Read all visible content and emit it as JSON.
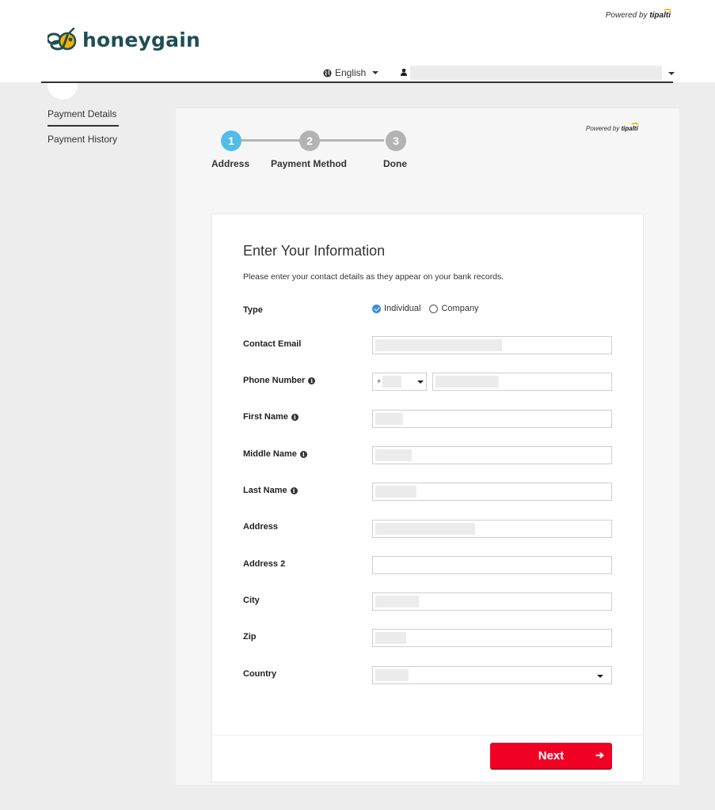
{
  "header": {
    "powered_by_prefix": "Powered by",
    "powered_by_brand": "tipalti",
    "logo_text": "honeygain",
    "language": "English"
  },
  "sidenav": {
    "items": [
      {
        "label": "Payment Details",
        "active": true
      },
      {
        "label": "Payment History",
        "active": false
      }
    ]
  },
  "panel": {
    "powered_by_prefix": "Powered by",
    "powered_by_brand": "tipalti"
  },
  "stepper": {
    "steps": [
      {
        "number": "1",
        "label": "Address",
        "active": true
      },
      {
        "number": "2",
        "label": "Payment Method",
        "active": false
      },
      {
        "number": "3",
        "label": "Done",
        "active": false
      }
    ]
  },
  "form": {
    "title": "Enter Your Information",
    "subtitle": "Please enter your contact details as they appear on your bank records.",
    "type": {
      "label": "Type",
      "options": [
        "Individual",
        "Company"
      ],
      "selected": "Individual"
    },
    "labels": {
      "contact_email": "Contact Email",
      "phone_number": "Phone Number",
      "first_name": "First Name",
      "middle_name": "Middle Name",
      "last_name": "Last Name",
      "address": "Address",
      "address2": "Address 2",
      "city": "City",
      "zip": "Zip",
      "country": "Country"
    },
    "phone_prefix": "+",
    "info_glyph": "i",
    "next_label": "Next",
    "next_arrow": "➔"
  },
  "colors": {
    "accent_blue": "#52bde8",
    "next_red": "#ef0024",
    "logo_teal": "#1f4e55"
  },
  "icons": {
    "globe": "globe-icon",
    "user": "user-icon",
    "info": "info-icon",
    "arrow": "arrow-right-icon"
  }
}
